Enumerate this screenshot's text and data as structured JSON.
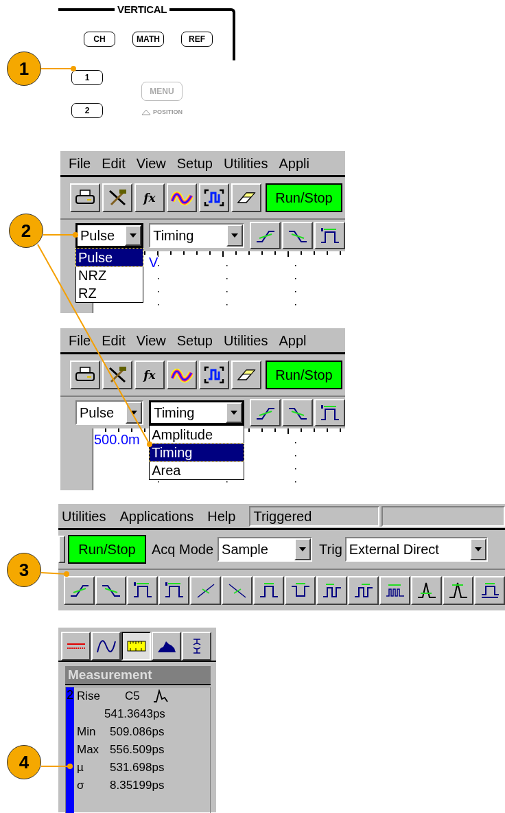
{
  "callouts": [
    "1",
    "2",
    "3",
    "4"
  ],
  "front_panel": {
    "title": "VERTICAL",
    "top_buttons": [
      {
        "label": "CH",
        "disabled": false
      },
      {
        "label": "MATH",
        "disabled": false
      },
      {
        "label": "REF",
        "disabled": false
      }
    ],
    "channel_buttons": [
      {
        "label": "1",
        "disabled": false
      },
      {
        "label": "2",
        "disabled": false
      }
    ],
    "menu_button": {
      "label": "MENU",
      "disabled": true
    },
    "position_label": "POSITION"
  },
  "screens": [
    {
      "menu": [
        "File",
        "Edit",
        "View",
        "Setup",
        "Utilities",
        "Appli"
      ],
      "function_label": "fx",
      "run_stop": "Run/Stop",
      "type_select": {
        "value": "Pulse",
        "expanded": true,
        "options": [
          {
            "label": "Pulse",
            "selected": true
          },
          {
            "label": "NRZ",
            "selected": false
          },
          {
            "label": "RZ",
            "selected": false
          }
        ]
      },
      "category_select": {
        "value": "Timing",
        "expanded": false
      },
      "scale_label": "V"
    },
    {
      "menu": [
        "File",
        "Edit",
        "View",
        "Setup",
        "Utilities",
        "Appl"
      ],
      "function_label": "fx",
      "run_stop": "Run/Stop",
      "type_select": {
        "value": "Pulse",
        "expanded": false
      },
      "category_select": {
        "value": "Timing",
        "expanded": true,
        "options": [
          {
            "label": "Amplitude",
            "selected": false
          },
          {
            "label": "Timing",
            "selected": true
          },
          {
            "label": "Area",
            "selected": false
          }
        ]
      },
      "scale_label": "500.0m"
    }
  ],
  "toolbar_screen": {
    "menu": [
      "Utilities",
      "Applications",
      "Help"
    ],
    "status": "Triggered",
    "run_stop": "Run/Stop",
    "acq_mode_label": "Acq Mode",
    "acq_mode": "Sample",
    "trig_label": "Trig",
    "trig": "External Direct"
  },
  "measurement_panel": {
    "tabs": [
      {
        "selected": false
      },
      {
        "selected": false
      },
      {
        "selected": true
      },
      {
        "selected": false
      },
      {
        "selected": false
      }
    ],
    "title": "Measurement",
    "readout": {
      "index": "2",
      "name": "Rise",
      "source": "C5",
      "value": "541.3643ps",
      "stats": [
        {
          "label": "Min",
          "value": "509.086ps"
        },
        {
          "label": "Max",
          "value": "556.509ps"
        },
        {
          "label": "µ",
          "value": "531.698ps"
        },
        {
          "label": "σ",
          "value": "8.35199ps"
        }
      ]
    }
  }
}
